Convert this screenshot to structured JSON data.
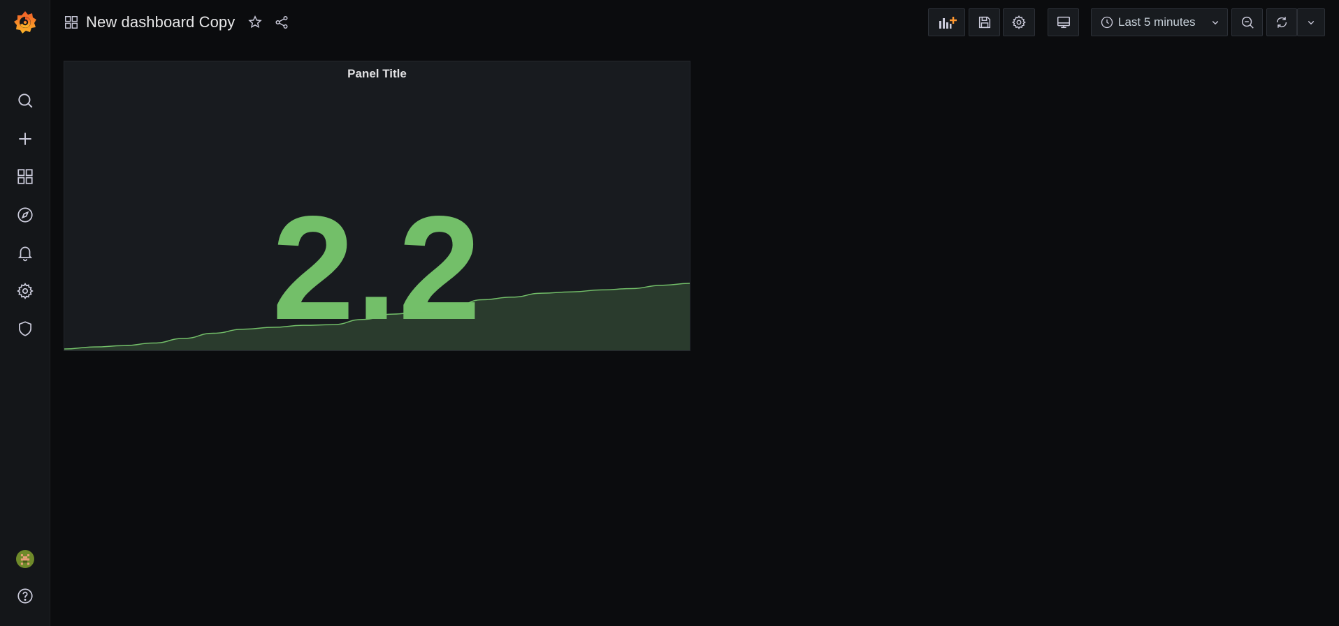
{
  "topbar": {
    "dashboard_title": "New dashboard Copy",
    "time_range": "Last 5 minutes"
  },
  "panel": {
    "title": "Panel Title",
    "value": "2.2",
    "color": "#73bf69"
  },
  "icons": {
    "logo": "grafana-logo",
    "sidebar": [
      "search-icon",
      "plus-icon",
      "dashboards-icon",
      "explore-icon",
      "alerting-icon",
      "configuration-icon",
      "shield-icon"
    ],
    "bottom": [
      "avatar",
      "help-icon"
    ]
  },
  "chart_data": {
    "type": "area",
    "values": [
      0.0,
      0.03,
      0.05,
      0.09,
      0.16,
      0.24,
      0.3,
      0.33,
      0.36,
      0.37,
      0.45,
      0.53,
      0.57,
      0.63,
      0.75,
      0.79,
      0.85,
      0.87,
      0.9,
      0.92,
      0.97,
      1.0
    ],
    "color": "#73bf69"
  }
}
